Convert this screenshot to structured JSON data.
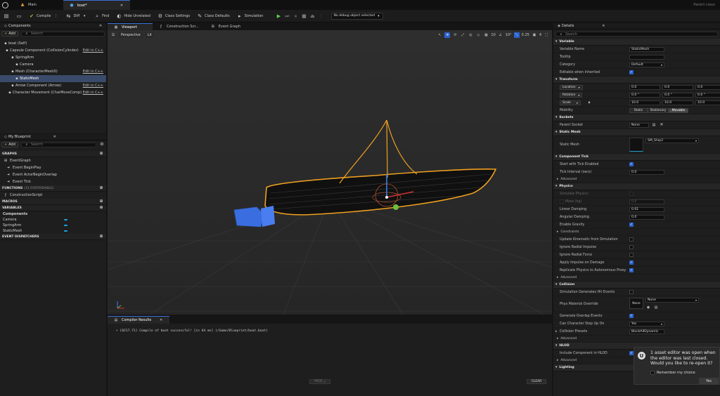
{
  "titlebar": {
    "tabs": [
      {
        "label": "Main",
        "active": false
      },
      {
        "label": "boat*",
        "active": true
      }
    ],
    "right_label": "Parent class:"
  },
  "toolbar": {
    "compile": "Compile",
    "diff": "Diff",
    "find": "Find",
    "hide_unrelated": "Hide Unrelated",
    "class_settings": "Class Settings",
    "class_defaults": "Class Defaults",
    "simulation": "Simulation",
    "debug_select": "No debug object selected"
  },
  "components": {
    "title": "Components",
    "add": "Add",
    "search_placeholder": "Search",
    "items": [
      {
        "label": "boat (Self)",
        "indent": 4,
        "edit": ""
      },
      {
        "label": "Capsule Component (CollisionCylinder)",
        "indent": 6,
        "edit": "Edit in C++"
      },
      {
        "label": "SpringArm",
        "indent": 14,
        "edit": ""
      },
      {
        "label": "Camera",
        "indent": 20,
        "edit": ""
      },
      {
        "label": "Mesh (CharacterMesh0)",
        "indent": 14,
        "edit": "Edit in C++"
      },
      {
        "label": "StaticMesh",
        "indent": 20,
        "edit": ""
      },
      {
        "label": "Arrow Component (Arrow)",
        "indent": 14,
        "edit": "Edit in C++"
      },
      {
        "label": "Character Movement (CharMoveComp)",
        "indent": 10,
        "edit": "Edit in C++"
      }
    ]
  },
  "blueprint": {
    "title": "My Blueprint",
    "add": "Add",
    "search_placeholder": "Search",
    "graphs_label": "GRAPHS",
    "event_graph": "EventGraph",
    "events": [
      "Event BeginPlay",
      "Event ActorBeginOverlap",
      "Event Tick"
    ],
    "functions_label": "FUNCTIONS",
    "functions_overridable": "(33 OVERRIDABLE)",
    "construction_script": "ConstructionScript",
    "macros_label": "MACROS",
    "variables_label": "VARIABLES",
    "components_label": "Components",
    "variables": [
      "Camera",
      "SpringArm",
      "StaticMesh"
    ],
    "dispatchers_label": "EVENT DISPATCHERS"
  },
  "editor_tabs": [
    "Viewport",
    "Construction Scr...",
    "Event Graph"
  ],
  "viewport": {
    "perspective": "Perspective",
    "lit": "Lit",
    "snap_grid": "10",
    "snap_rot": "10°",
    "snap_scale": "0.25",
    "camera_speed": "4"
  },
  "compiler": {
    "title": "Compiler Results",
    "message": "[0217.71] Compile of boat successful! [in 64 ms] (/Game/Blueprint/boat.boat)",
    "page": "PAGE",
    "clear": "CLEAR"
  },
  "details": {
    "title": "Details",
    "search_placeholder": "Search",
    "variable": {
      "section": "Variable",
      "name_label": "Variable Name",
      "name_value": "StaticMesh",
      "tooltip_label": "Tooltip",
      "category_label": "Category",
      "category_value": "Default",
      "editable_label": "Editable when Inherited"
    },
    "transform": {
      "section": "Transform",
      "location": "Location",
      "rotation": "Rotation",
      "scale": "Scale",
      "loc_values": [
        "0.0",
        "0.0",
        "0.0"
      ],
      "rot_values": [
        "0.0 °",
        "0.0 °",
        "0.0 °"
      ],
      "scale_values": [
        "10.0",
        "10.0",
        "10.0"
      ],
      "mobility": "Mobility",
      "mobility_options": [
        "Static",
        "Stationary",
        "Movable"
      ]
    },
    "sockets": {
      "section": "Sockets",
      "parent_label": "Parent Socket",
      "parent_value": "None"
    },
    "static_mesh": {
      "section": "Static Mesh",
      "label": "Static Mesh",
      "value": "SM_Ship2"
    },
    "tick": {
      "section": "Component Tick",
      "start_label": "Start with Tick Enabled",
      "interval_label": "Tick Interval (secs)",
      "interval_value": "0.0",
      "advanced": "Advanced"
    },
    "physics": {
      "section": "Physics",
      "simulate_label": "Simulate Physics",
      "mass_label": "Mass (kg)",
      "mass_value": "0.0",
      "linear_label": "Linear Damping",
      "linear_value": "0.01",
      "angular_label": "Angular Damping",
      "angular_value": "0.0",
      "gravity_label": "Enable Gravity",
      "constraints": "Constraints",
      "update_kin": "Update Kinematic from Simulation",
      "ignore_impulse": "Ignore Radial Impulse",
      "ignore_force": "Ignore Radial Force",
      "apply_impulse": "Apply Impulse on Damage",
      "replicate": "Replicate Physics to Autonomous Proxy",
      "advanced": "Advanced"
    },
    "collision": {
      "section": "Collision",
      "sim_hit": "Simulation Generates Hit Events",
      "phys_mat": "Phys Material Override",
      "phys_mat_thumb": "None",
      "phys_mat_value": "None",
      "overlap": "Generate Overlap Events",
      "step_up": "Can Character Step Up On",
      "step_up_value": "Yes",
      "presets": "Collision Presets",
      "presets_value": "BlockAllDynamic",
      "advanced": "Advanced"
    },
    "hlod": {
      "section": "HLOD",
      "include": "Include Component in HLOD",
      "advanced": "Advanced"
    },
    "lighting": {
      "section": "Lighting"
    }
  },
  "notification": {
    "text": "1 asset editor was open when the editor was last closed. Would you like to re-open it?",
    "remember": "Remember my choice",
    "yes": "Yes"
  }
}
